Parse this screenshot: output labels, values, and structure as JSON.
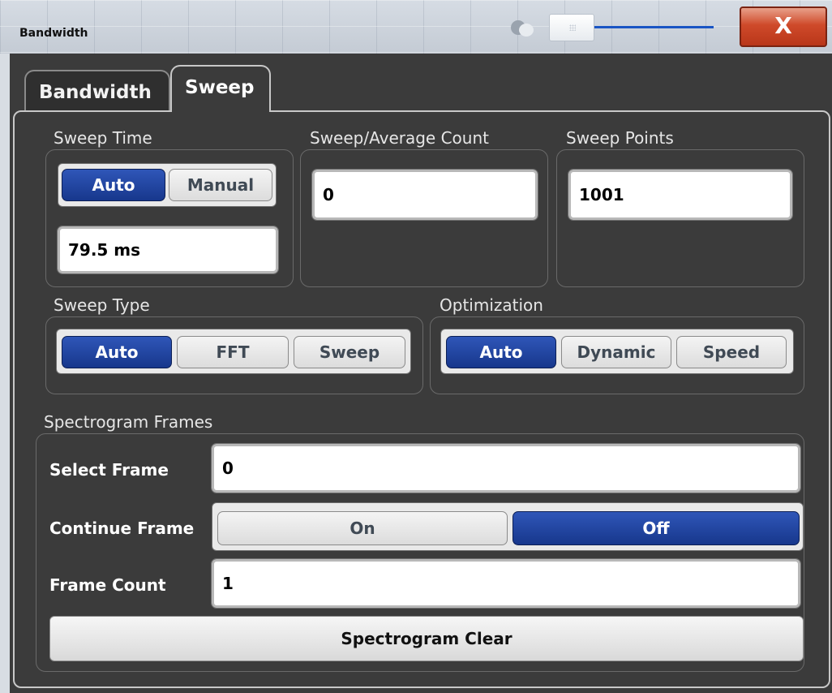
{
  "window": {
    "title": "Bandwidth",
    "close_label": "X",
    "slider_level": 0.05
  },
  "tabs": [
    {
      "label": "Bandwidth",
      "active": false
    },
    {
      "label": "Sweep",
      "active": true
    }
  ],
  "sweep_time": {
    "label": "Sweep Time",
    "auto_label": "Auto",
    "manual_label": "Manual",
    "selected": "Auto",
    "value": "79.5 ms"
  },
  "sweep_average_count": {
    "label": "Sweep/Average Count",
    "value": "0"
  },
  "sweep_points": {
    "label": "Sweep Points",
    "value": "1001"
  },
  "sweep_type": {
    "label": "Sweep Type",
    "options": [
      "Auto",
      "FFT",
      "Sweep"
    ],
    "selected": "Auto"
  },
  "optimization": {
    "label": "Optimization",
    "options": [
      "Auto",
      "Dynamic",
      "Speed"
    ],
    "selected": "Auto"
  },
  "spectrogram_frames": {
    "label": "Spectrogram Frames",
    "select_frame_label": "Select Frame",
    "select_frame_value": "0",
    "continue_frame_label": "Continue Frame",
    "continue_on_label": "On",
    "continue_off_label": "Off",
    "continue_selected": "Off",
    "frame_count_label": "Frame Count",
    "frame_count_value": "1",
    "clear_label": "Spectrogram Clear"
  },
  "colors": {
    "selected_button": "#1f43a0",
    "close_button": "#cf4a2a",
    "dialog_background": "#3b3b3b"
  }
}
